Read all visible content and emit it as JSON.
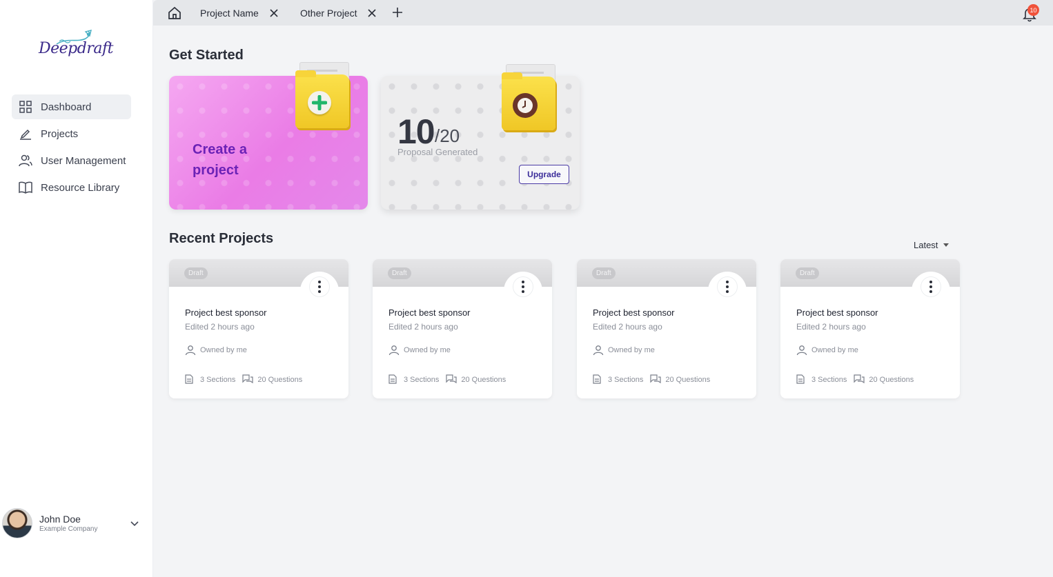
{
  "app": {
    "logo_text": "Deepdraft"
  },
  "sidebar": {
    "items": [
      {
        "label": "Dashboard",
        "icon": "grid-icon",
        "active": true
      },
      {
        "label": "Projects",
        "icon": "pen-icon",
        "active": false
      },
      {
        "label": "User Management",
        "icon": "users-icon",
        "active": false
      },
      {
        "label": "Resource Library",
        "icon": "book-icon",
        "active": false
      }
    ],
    "user": {
      "name": "John Doe",
      "company": "Example Company"
    }
  },
  "tabs": [
    {
      "label": "Project Name"
    },
    {
      "label": "Other Project"
    }
  ],
  "notifications": {
    "count": "10"
  },
  "get_started": {
    "title": "Get Started",
    "create_label": "Create a project",
    "usage": {
      "used": "10",
      "total": "/20",
      "label": "Proposal Generated",
      "button": "Upgrade"
    }
  },
  "recent": {
    "title": "Recent Projects",
    "sort_label": "Latest",
    "projects": [
      {
        "status": "Draft",
        "title": "Project best sponsor",
        "edited": "Edited 2 hours ago",
        "owner": "Owned by me",
        "sections": "3 Sections",
        "questions": "20 Questions"
      },
      {
        "status": "Draft",
        "title": "Project best sponsor",
        "edited": "Edited 2 hours ago",
        "owner": "Owned by me",
        "sections": "3 Sections",
        "questions": "20 Questions"
      },
      {
        "status": "Draft",
        "title": "Project best sponsor",
        "edited": "Edited 2 hours ago",
        "owner": "Owned by me",
        "sections": "3 Sections",
        "questions": "20 Questions"
      },
      {
        "status": "Draft",
        "title": "Project best sponsor",
        "edited": "Edited 2 hours ago",
        "owner": "Owned by me",
        "sections": "3 Sections",
        "questions": "20 Questions"
      }
    ]
  },
  "colors": {
    "accent": "#6b22b6",
    "create_card": "#ea7ce6",
    "badge": "#f0533b",
    "folder": "#f0c726"
  }
}
